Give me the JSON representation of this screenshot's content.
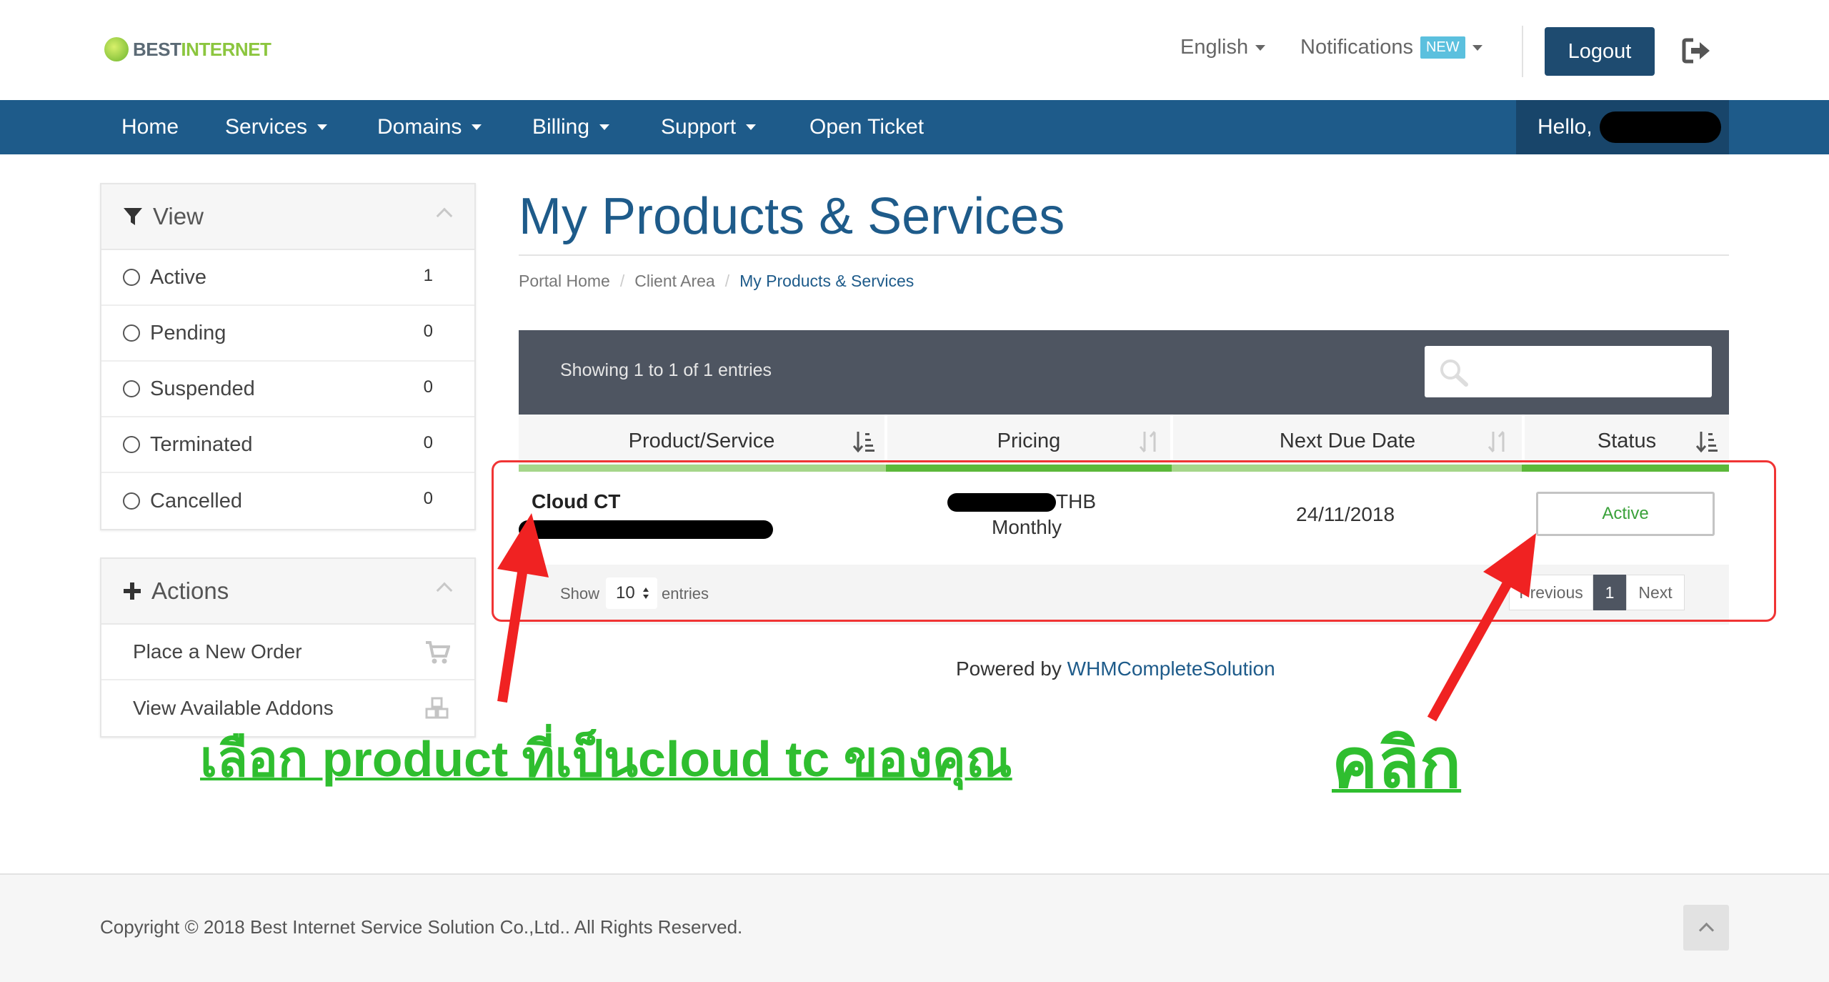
{
  "brand": {
    "part1": "BEST",
    "part2": "INTERNET"
  },
  "header": {
    "language": "English",
    "notifications": "Notifications",
    "new_badge": "NEW",
    "logout": "Logout"
  },
  "nav": {
    "items": [
      {
        "label": "Home",
        "dropdown": false
      },
      {
        "label": "Services",
        "dropdown": true
      },
      {
        "label": "Domains",
        "dropdown": true
      },
      {
        "label": "Billing",
        "dropdown": true
      },
      {
        "label": "Support",
        "dropdown": true
      },
      {
        "label": "Open Ticket",
        "dropdown": false
      }
    ],
    "hello": "Hello,"
  },
  "sidebar": {
    "view": {
      "title": "View",
      "items": [
        {
          "label": "Active",
          "count": "1"
        },
        {
          "label": "Pending",
          "count": "0"
        },
        {
          "label": "Suspended",
          "count": "0"
        },
        {
          "label": "Terminated",
          "count": "0"
        },
        {
          "label": "Cancelled",
          "count": "0"
        }
      ]
    },
    "actions": {
      "title": "Actions",
      "items": [
        {
          "label": "Place a New Order",
          "icon": "cart-icon"
        },
        {
          "label": "View Available Addons",
          "icon": "cubes-icon"
        }
      ]
    }
  },
  "page": {
    "title": "My Products & Services",
    "breadcrumb": [
      "Portal Home",
      "Client Area",
      "My Products & Services"
    ]
  },
  "table": {
    "showing": "Showing 1 to 1 of 1 entries",
    "columns": [
      "Product/Service",
      "Pricing",
      "Next Due Date",
      "Status"
    ],
    "row": {
      "product": "Cloud CT",
      "currency": "THB",
      "cycle": "Monthly",
      "due_date": "24/11/2018",
      "status": "Active"
    },
    "footer": {
      "show": "Show",
      "length": "10",
      "entries": "entries",
      "previous": "Previous",
      "page": "1",
      "next": "Next"
    }
  },
  "powered": {
    "prefix": "Powered by",
    "link": "WHMCompleteSolution"
  },
  "annotations": {
    "select_product": "เลือก product ที่เป็นcloud tc ของคุณ",
    "click": "คลิก"
  },
  "footer": {
    "copyright": "Copyright © 2018 Best Internet Service Solution Co.,Ltd.. All Rights Reserved."
  },
  "colors": {
    "brand_blue": "#1e5b8a",
    "brand_green": "#8cc63f",
    "status_green": "#3aa13a",
    "annotation_green": "#2fbe2f",
    "annotation_red": "#f03434",
    "new_badge": "#5bc0de"
  }
}
